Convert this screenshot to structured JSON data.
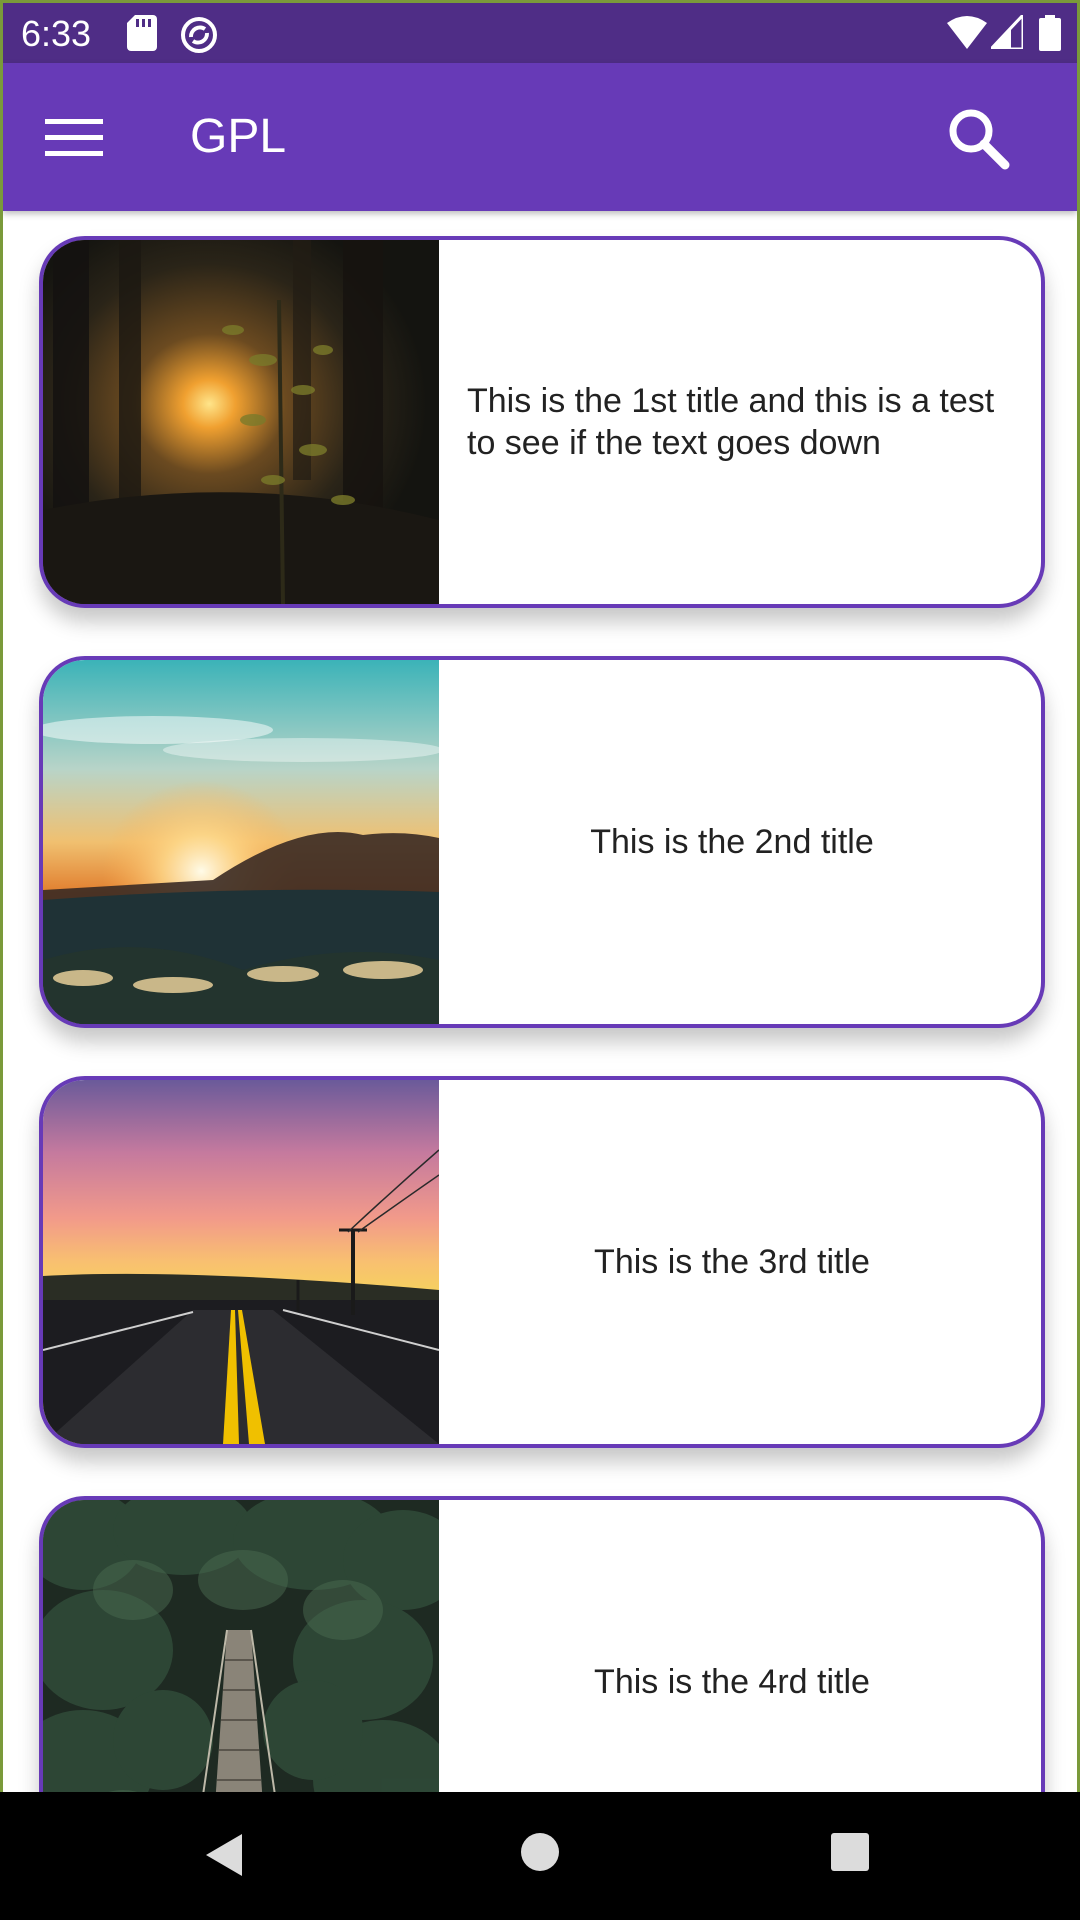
{
  "status_bar": {
    "time": "6:33",
    "icons_left": [
      "sd-card-icon",
      "sync-icon"
    ],
    "icons_right": [
      "wifi-icon",
      "signal-icon",
      "battery-icon"
    ]
  },
  "app_bar": {
    "title": "GPL",
    "menu_icon": "hamburger-menu-icon",
    "search_icon": "search-icon",
    "color": "#673ab7",
    "status_color": "#4f2d86"
  },
  "cards": [
    {
      "title": "This is the 1st title and this is a test to see if the text goes down",
      "image": "forest-sunset"
    },
    {
      "title": "This is the 2nd title",
      "image": "mountain-sunset"
    },
    {
      "title": "This is the 3rd title",
      "image": "road-sunset"
    },
    {
      "title": "This is the 4rd title",
      "image": "forest-bridge"
    }
  ],
  "nav_bar": {
    "back_icon": "back-triangle-icon",
    "home_icon": "home-circle-icon",
    "recents_icon": "recents-square-icon"
  }
}
